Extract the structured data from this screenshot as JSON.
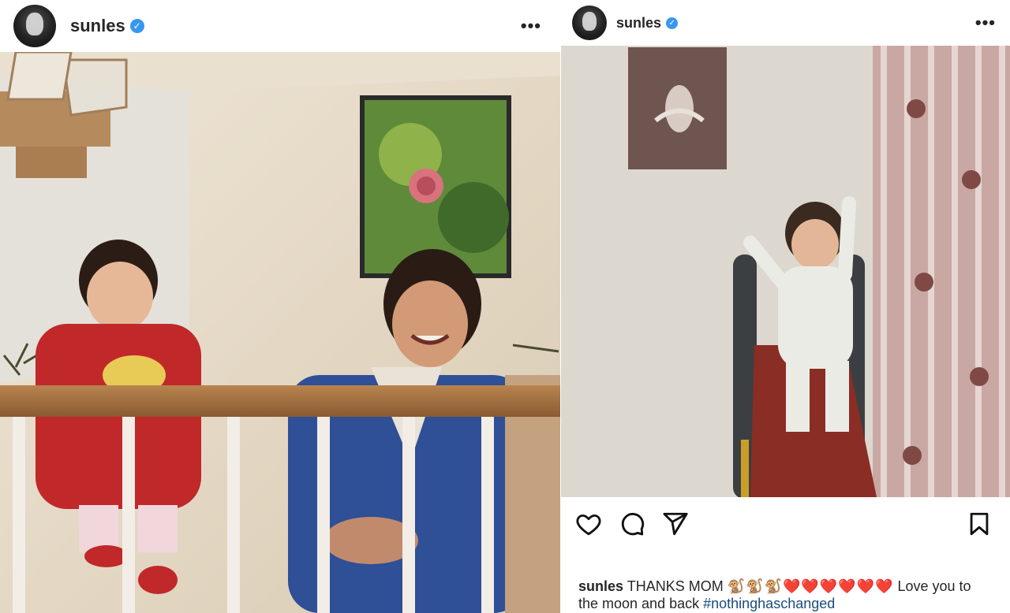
{
  "posts": [
    {
      "username": "sunles",
      "verified_glyph": "✓",
      "more_icon": "more-horizontal-icon",
      "more_glyph": "•••",
      "photo": "vintage photo of a toddler in red outfit holding bananas beside a smiling woman in a blue suit behind a wooden railing"
    },
    {
      "username": "sunles",
      "verified_glyph": "✓",
      "more_icon": "more-horizontal-icon",
      "more_glyph": "•••",
      "photo": "vintage photo of a smiling toddler in white on a red slide next to floral curtains, ballerina picture on wall",
      "actions": [
        "heart-icon",
        "comment-icon",
        "share-icon",
        "bookmark-icon"
      ],
      "caption": {
        "username": "sunles",
        "text_before": " THANKS MOM ",
        "emojis": "🐒🐒🐒❤️❤️❤️❤️❤️❤️",
        "text_after": " Love you to the moon and back ",
        "hashtag": "#nothinghaschanged"
      }
    }
  ],
  "colors": {
    "verified": "#3897f0",
    "hashtag": "#1a4b7f",
    "text": "#262626"
  }
}
